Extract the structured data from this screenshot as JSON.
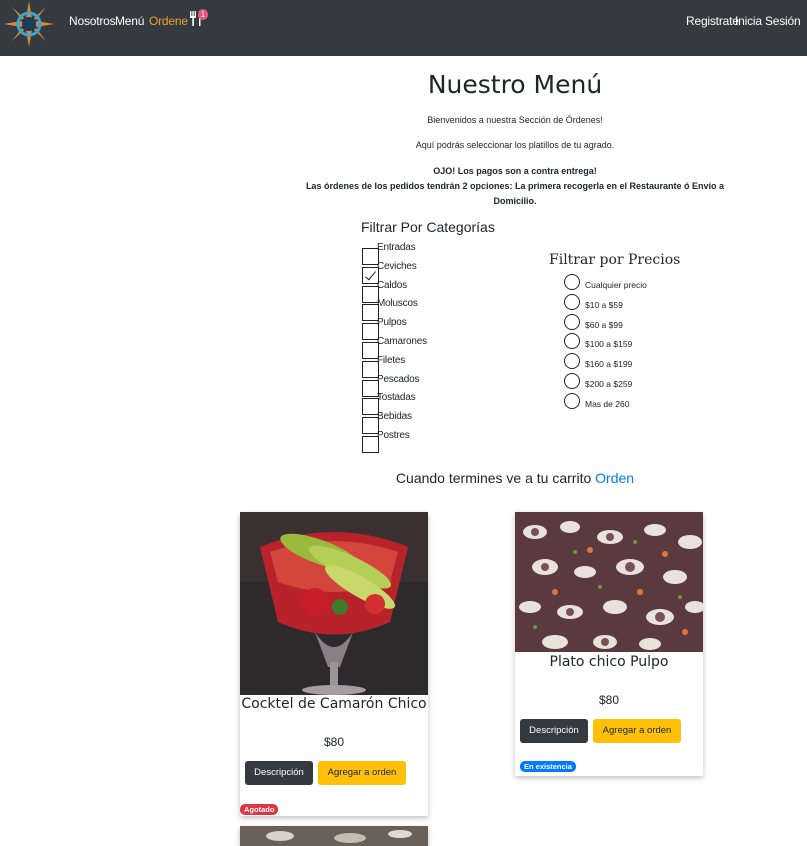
{
  "navbar": {
    "links": [
      "Nosotros",
      "Menú",
      "Ordene"
    ],
    "cart_count": "1",
    "right_links": [
      "Registrate",
      "Inicia Sesión"
    ],
    "colors": {
      "background": "#343a40",
      "active": "#f0a030"
    }
  },
  "page": {
    "title": "Nuestro Menú",
    "welcome": "Bienvenidos a nuestra Sección de Órdenes!",
    "select": "Aquí podrás seleccionar los platillos de tu agrado.",
    "notice_1": "OJO! Los pagos son a contra entrega!",
    "notice_2": "Las órdenes de los pedidos tendrán 2 opciones: La primera recogerla en el Restaurante ó Envío a Domicilio."
  },
  "filters": {
    "categories_title": "Filtrar Por Categorías",
    "categories": [
      {
        "label": "Entradas",
        "checked": false
      },
      {
        "label": "Ceviches",
        "checked": true
      },
      {
        "label": "Caldos",
        "checked": false
      },
      {
        "label": "Moluscos",
        "checked": false
      },
      {
        "label": "Pulpos",
        "checked": false
      },
      {
        "label": "Camarones",
        "checked": false
      },
      {
        "label": "Filetes",
        "checked": false
      },
      {
        "label": "Pescados",
        "checked": false
      },
      {
        "label": "Tostadas",
        "checked": false
      },
      {
        "label": "Bebidas",
        "checked": false
      },
      {
        "label": "Postres",
        "checked": false
      }
    ],
    "prices_title": "Filtrar por Precios",
    "prices": [
      "Cualquier precio",
      "$10 a $59",
      "$60 a $99",
      "$100 a $159",
      "$160 a $199",
      "$200 a $259",
      "Mas de 260"
    ]
  },
  "cart_prompt": {
    "text": "Cuando termines ve a tu carrito ",
    "link": "Orden"
  },
  "products": [
    {
      "name": "Cocktel de Camarón Chico",
      "price": "$80",
      "desc_button": "Descripción",
      "add_button": "Agregar a orden",
      "badge": "Agotado",
      "badge_color": "#dc3545"
    },
    {
      "name": "Plato chico Pulpo",
      "price": "$80",
      "desc_button": "Descripción",
      "add_button": "Agregar a orden",
      "badge": "En existencia",
      "badge_color": "#007bff"
    }
  ]
}
